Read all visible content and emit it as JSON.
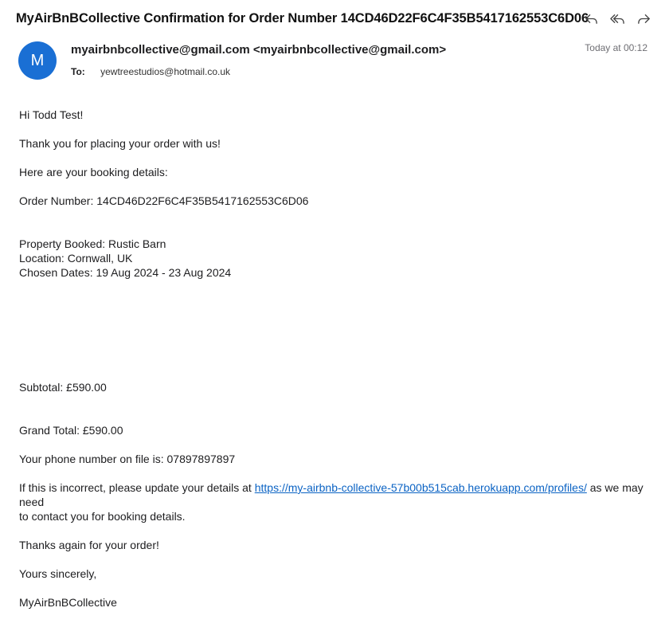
{
  "email": {
    "subject": "MyAirBnBCollective Confirmation for Order Number 14CD46D22F6C4F35B5417162553C6D06",
    "avatar_letter": "M",
    "avatar_color": "#1a6fd4",
    "from": "myairbnbcollective@gmail.com <myairbnbcollective@gmail.com>",
    "to_label": "To:",
    "to_address": "yewtreestudios@hotmail.co.uk",
    "date": "Today at 00:12",
    "actions": [
      "reply-icon",
      "reply-all-icon",
      "forward-icon"
    ]
  },
  "body": {
    "greeting": "Hi Todd Test!",
    "thanks": "Thank you for placing your order with us!",
    "details_intro": "Here are your booking details:",
    "order_number": "Order Number: 14CD46D22F6C4F35B5417162553C6D06",
    "property": "Property Booked: Rustic Barn",
    "location": "Location: Cornwall, UK",
    "dates": "Chosen Dates: 19 Aug 2024 - 23 Aug 2024",
    "subtotal": "Subtotal: £590.00",
    "grand_total": "Grand Total: £590.00",
    "phone": "Your phone number on file is: 07897897897",
    "incorrect_prefix": "If this is incorrect, please update your details at ",
    "profile_link": "https://my-airbnb-collective-57b00b515cab.herokuapp.com/profiles/",
    "incorrect_suffix": " as we may need",
    "contact_line": "to contact you for booking details.",
    "thanks_again": "Thanks again for your order!",
    "signoff": "Yours sincerely,",
    "signature": "MyAirBnBCollective"
  },
  "colors": {
    "link": "#0b63c4",
    "muted": "#6e6e73"
  }
}
